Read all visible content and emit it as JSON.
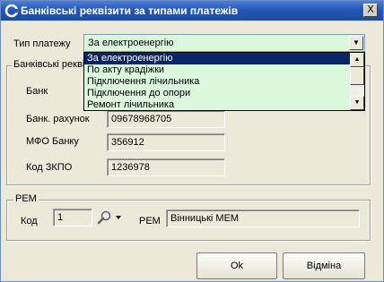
{
  "window": {
    "title": "Банківські реквізити за типами платежів",
    "close_glyph": "X"
  },
  "payment_type": {
    "label": "Тип платежу",
    "selected": "За електроенергію",
    "options": [
      "За електроенергію",
      "По акту крадіжки",
      "Підключення лічильника",
      "Підключення до опори",
      "Ремонт лічильника"
    ]
  },
  "bank_group": {
    "title": "Банківські реквізити",
    "bank_label": "Банк",
    "account_label": "Банк. рахунок",
    "account_value": "09678968705",
    "mfo_label": "МФО Банку",
    "mfo_value": "356912",
    "edrpou_label": "Код ЗКПО",
    "edrpou_value": "1236978"
  },
  "rem_group": {
    "title": "РЕМ",
    "code_label": "Код",
    "code_value": "1",
    "rem_label": "РЕМ",
    "rem_value": "Вінницькі МЕМ"
  },
  "buttons": {
    "ok": "Ok",
    "cancel": "Відміна"
  }
}
